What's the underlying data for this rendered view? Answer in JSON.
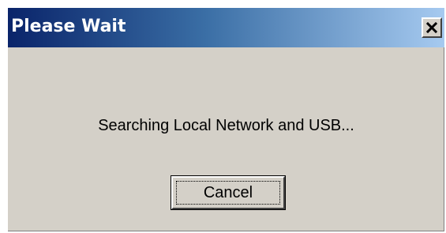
{
  "window": {
    "title": "Please Wait",
    "close_icon": "close-icon",
    "titlebar_gradient": [
      "#0a246a",
      "#3a6ea5",
      "#a6caf0"
    ],
    "background_color": "#d4d0c8"
  },
  "message": {
    "text": "Searching Local Network and USB..."
  },
  "buttons": {
    "cancel_label": "Cancel"
  }
}
